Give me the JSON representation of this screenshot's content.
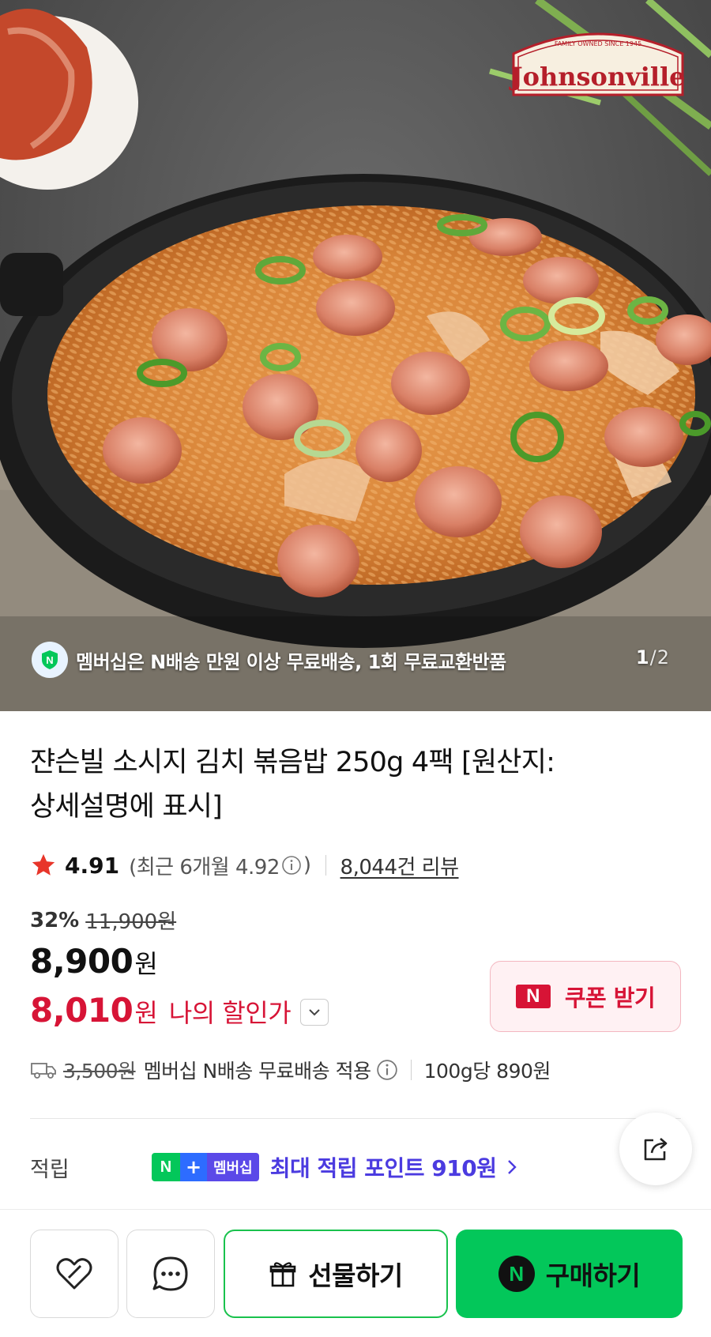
{
  "hero": {
    "brand": "Johnsonville",
    "brand_tagline": "FAMILY OWNED SINCE 1945",
    "notice": "멤버십은 N배송 만원 이상 무료배송, 1회 무료교환반품",
    "pager_current": "1",
    "pager_sep": "/",
    "pager_total": "2"
  },
  "product": {
    "title_line1": "쟌슨빌 소시지 김치 볶음밥 250g 4팩 [원산지:",
    "title_line2": "상세설명에 표시]",
    "rating": "4.91",
    "recent_rating": "(최근 6개월 4.92",
    "recent_rating_close": ")",
    "review_count": "8,044건 리뷰"
  },
  "pricing": {
    "discount_rate": "32%",
    "original_price": "11,900원",
    "price": "8,900",
    "price_unit": "원",
    "my_price": "8,010",
    "my_price_unit": "원",
    "my_price_label": "나의 할인가",
    "coupon_label": "쿠폰 받기",
    "accent_red": "#d71436"
  },
  "shipping": {
    "fee": "3,500원",
    "desc": "멤버십 N배송 무료배송 적용",
    "unit_price": "100g당 890원"
  },
  "points": {
    "label": "적립",
    "badge_n": "N",
    "badge_plus": "+",
    "badge_text": "멤버십",
    "link": "최대 적립 포인트 910원"
  },
  "bottom": {
    "gift_label": "선물하기",
    "buy_label": "구매하기",
    "npay_letter": "N",
    "brand_green": "#03c75a"
  },
  "icons": [
    "shield-n-icon",
    "star-icon",
    "info-icon",
    "chevron-down-icon",
    "truck-icon",
    "share-icon",
    "chevron-right-icon",
    "heart-icon",
    "chat-icon",
    "gift-icon",
    "naver-pay-icon"
  ]
}
